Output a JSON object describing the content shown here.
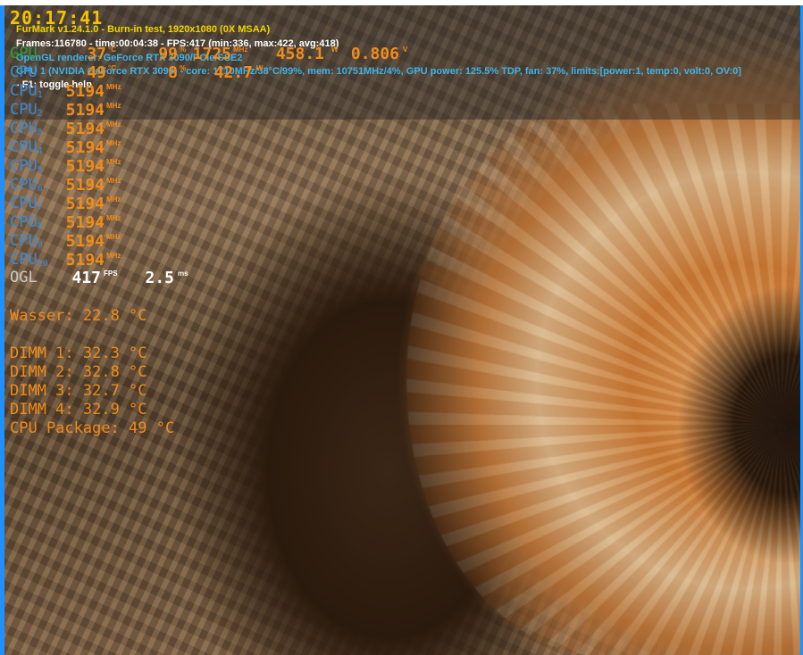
{
  "colors": {
    "accent_orange": "#f08c1a",
    "clock_yellow": "#f5c400",
    "label_blue": "#3a8bd9",
    "gpu_green": "#2aa23a",
    "window_border": "#1e90ff"
  },
  "overlay": {
    "clock": "20:17:41",
    "furmark": {
      "title": "FurMark v1.24.1.0 - Burn-in test, 1920x1080 (0X MSAA)",
      "frames": "Frames:116780 - time:00:04:38 - FPS:417 (min:336, max:422, avg:418)",
      "renderer": "OpenGL renderer: GeForce RTX 3090/PCIe/SSE2",
      "gpu_info": "GPU 1 (NVIDIA GeForce RTX 3090) - core: 1710MHz/38°C/99%, mem: 10751MHz/4%, GPU power: 125.5% TDP, fan: 37%, limits:[power:1, temp:0, volt:0, OV:0]",
      "help": "- F1: toggle help"
    },
    "gpu": {
      "label": "GPU",
      "temp": "37",
      "temp_unit": "°C",
      "load": "99",
      "load_unit": "%",
      "clock": "1725",
      "clock_unit": "MHz",
      "power": "458.1",
      "power_unit": "W",
      "voltage": "0.806",
      "voltage_unit": "V"
    },
    "cpu": {
      "label": "CPU",
      "temp": "49",
      "temp_unit": "°C",
      "load": "8",
      "load_unit": "%",
      "power": "42.7",
      "power_unit": "W"
    },
    "cores": [
      {
        "label": "CPU",
        "index": "1",
        "clock": "5194",
        "unit": "MHz"
      },
      {
        "label": "CPU",
        "index": "2",
        "clock": "5194",
        "unit": "MHz"
      },
      {
        "label": "CPU",
        "index": "3",
        "clock": "5194",
        "unit": "MHz"
      },
      {
        "label": "CPU",
        "index": "4",
        "clock": "5194",
        "unit": "MHz"
      },
      {
        "label": "CPU",
        "index": "5",
        "clock": "5194",
        "unit": "MHz"
      },
      {
        "label": "CPU",
        "index": "6",
        "clock": "5194",
        "unit": "MHz"
      },
      {
        "label": "CPU",
        "index": "7",
        "clock": "5194",
        "unit": "MHz"
      },
      {
        "label": "CPU",
        "index": "8",
        "clock": "5194",
        "unit": "MHz"
      },
      {
        "label": "CPU",
        "index": "9",
        "clock": "5194",
        "unit": "MHz"
      },
      {
        "label": "CPU",
        "index": "10",
        "clock": "5194",
        "unit": "MHz"
      }
    ],
    "ogl": {
      "label": "OGL",
      "fps": "417",
      "fps_unit": "FPS",
      "frametime": "2.5",
      "frametime_unit": "ms"
    },
    "sensors": {
      "water": "Wasser: 22.8 °C",
      "dimm1": "DIMM 1: 32.3 °C",
      "dimm2": "DIMM 2: 32.8 °C",
      "dimm3": "DIMM 3: 32.7 °C",
      "dimm4": "DIMM 4: 32.9 °C",
      "cpu_package": "CPU Package: 49 °C"
    }
  }
}
